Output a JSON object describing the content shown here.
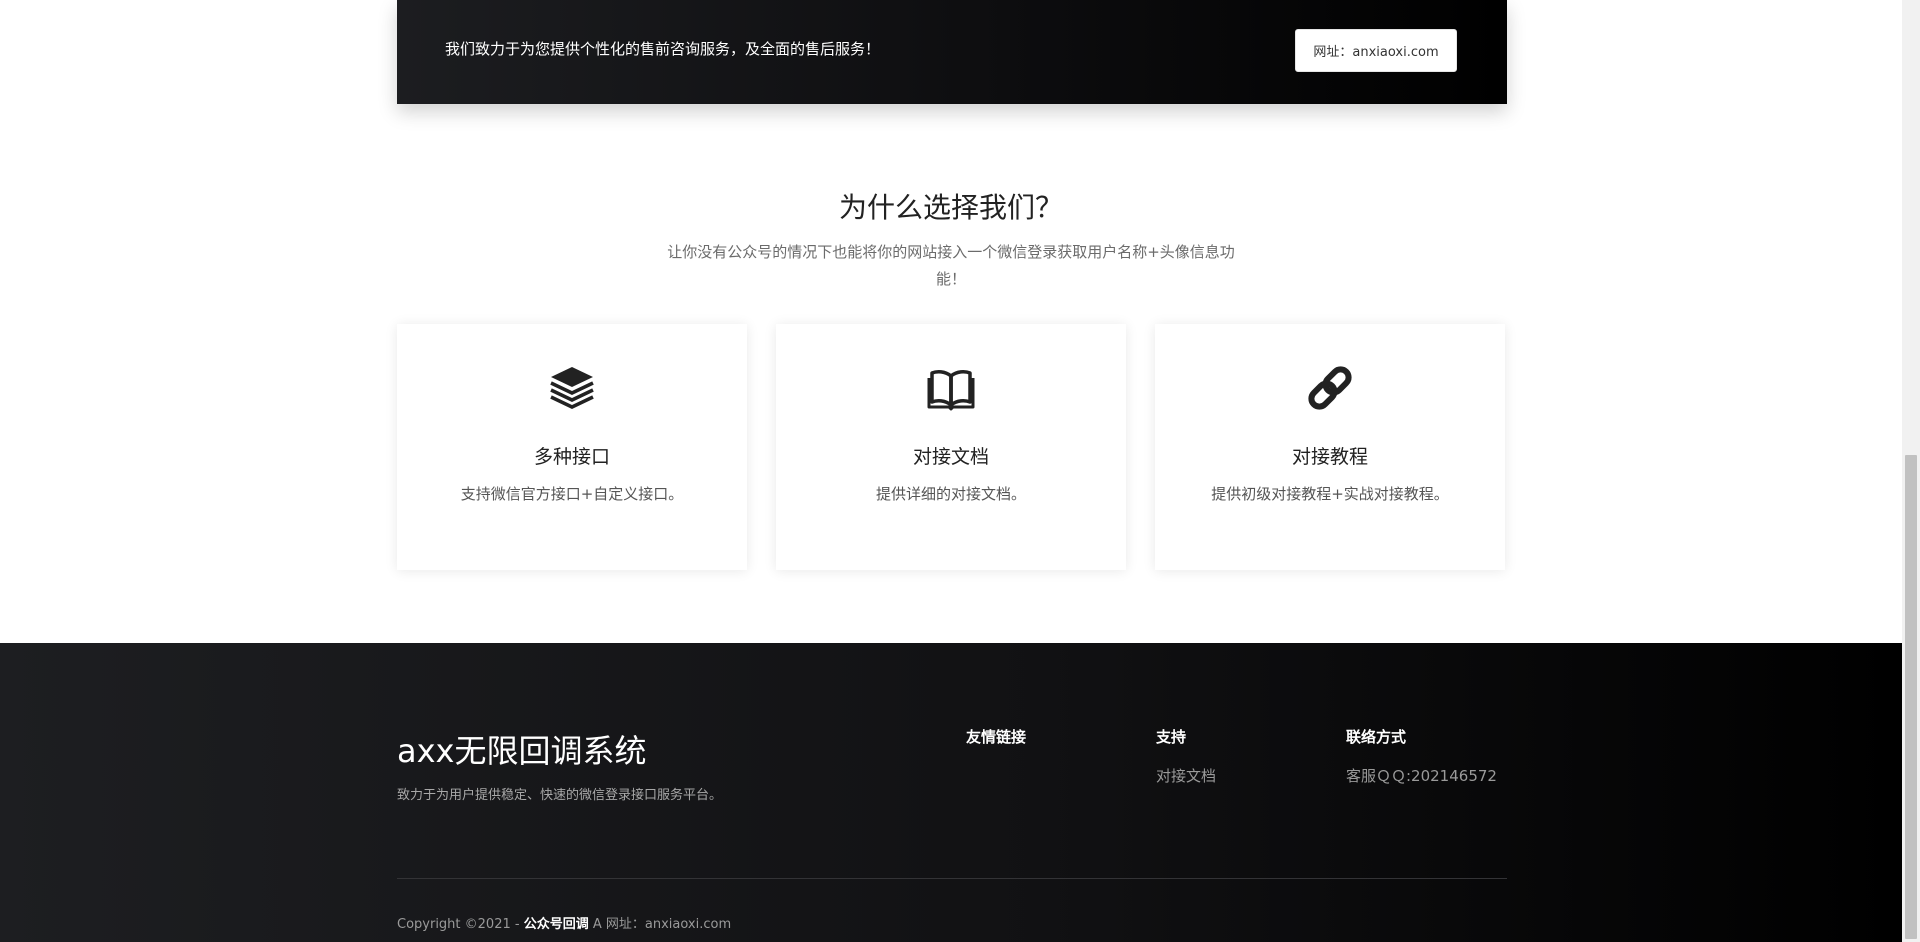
{
  "banner": {
    "text": "我们致力于为您提供个性化的售前咨询服务，及全面的售后服务！",
    "button_label": "网址：anxiaoxi.com"
  },
  "why": {
    "title": "为什么选择我们？",
    "subtitle": "让你没有公众号的情况下也能将你的网站接入一个微信登录获取用户名称+头像信息功能！"
  },
  "features": [
    {
      "icon": "layers-icon",
      "title": "多种接口",
      "desc": "支持微信官方接口+自定义接口。"
    },
    {
      "icon": "book-icon",
      "title": "对接文档",
      "desc": "提供详细的对接文档。"
    },
    {
      "icon": "link-icon",
      "title": "对接教程",
      "desc": "提供初级对接教程+实战对接教程。"
    }
  ],
  "footer": {
    "brand": "axx无限回调系统",
    "desc": "致力于为用户提供稳定、快速的微信登录接口服务平台。",
    "columns": [
      {
        "title": "友情链接",
        "items": []
      },
      {
        "title": "支持",
        "items": [
          "对接文档"
        ]
      },
      {
        "title": "联络方式",
        "items": [
          "客服ＱＱ:202146572"
        ]
      }
    ],
    "copyright_prefix": "Copyright ©2021 - ",
    "copyright_brand": "公众号回调",
    "copyright_suffix": " A 网址：anxiaoxi.com"
  }
}
